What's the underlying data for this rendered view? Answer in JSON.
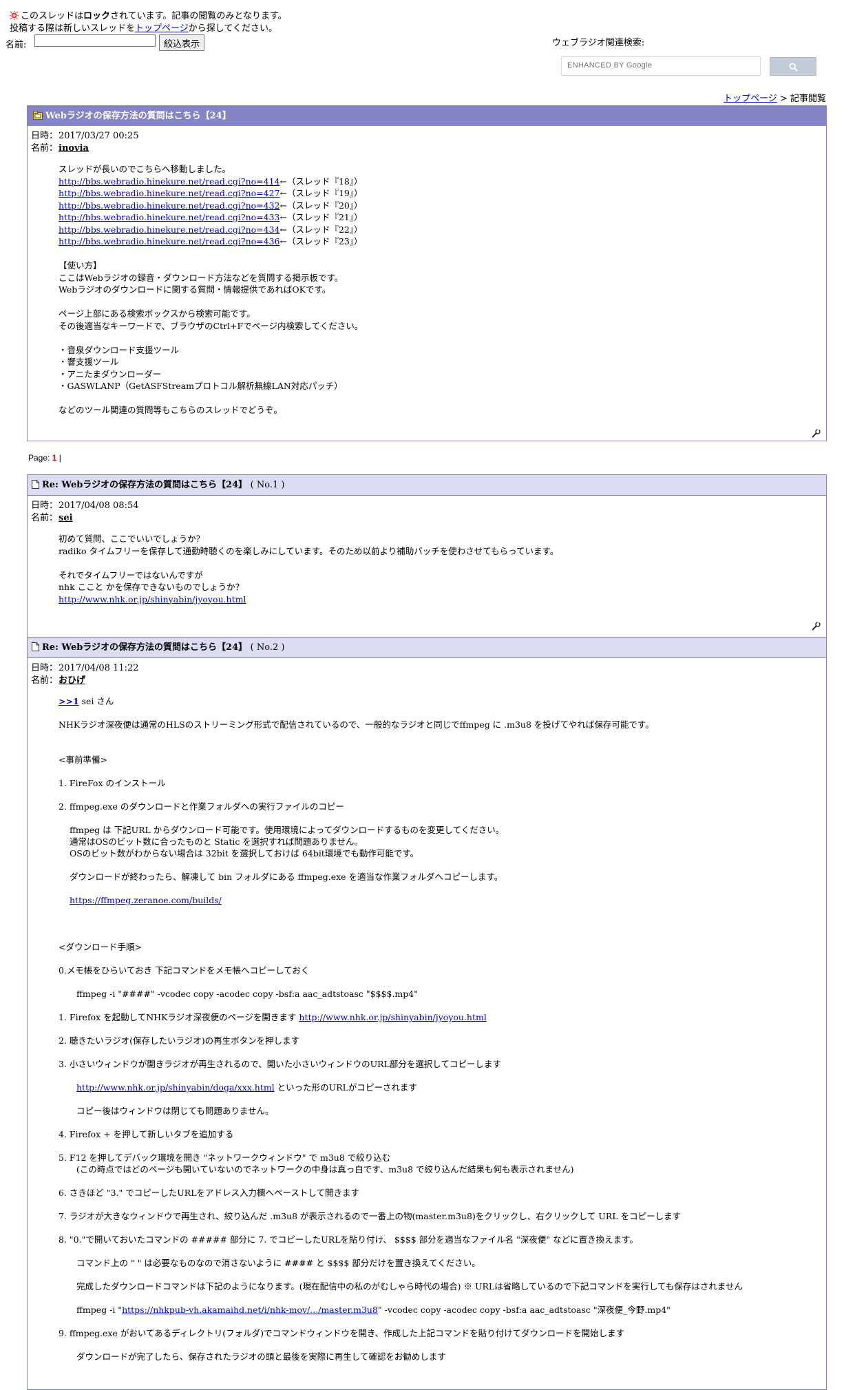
{
  "header": {
    "lock_pre": "このスレッドは",
    "lock_bold": "ロック",
    "lock_post": "されています。記事の閲覧のみとなります。",
    "new_pre": "投稿する際は新しいスレッドを",
    "new_link": "トップページ",
    "new_post": "から探してください。",
    "name_label": "名前:",
    "name_value": "",
    "filter_button": "絞込表示",
    "web_search_label": "ウェブラジオ関連検索:",
    "google_placeholder": "ENHANCED BY Google"
  },
  "breadcrumb": {
    "top": "トップページ",
    "sep": " > ",
    "current": "記事閲覧"
  },
  "thread": {
    "title": "Webラジオの保存方法の質問はこちら【24】",
    "date_label": "日時：",
    "date": "2017/03/27 00:25",
    "name_label": "名前：",
    "name": "inovia",
    "intro": "スレッドが長いのでこちらへ移動しました。",
    "links": [
      {
        "url": "http://bbs.webradio.hinekure.net/read.cgi?no=414",
        "note": "←（スレッド『18』）"
      },
      {
        "url": "http://bbs.webradio.hinekure.net/read.cgi?no=427",
        "note": "←（スレッド『19』）"
      },
      {
        "url": "http://bbs.webradio.hinekure.net/read.cgi?no=432",
        "note": "←（スレッド『20』）"
      },
      {
        "url": "http://bbs.webradio.hinekure.net/read.cgi?no=433",
        "note": "←（スレッド『21』）"
      },
      {
        "url": "http://bbs.webradio.hinekure.net/read.cgi?no=434",
        "note": "←（スレッド『22』）"
      },
      {
        "url": "http://bbs.webradio.hinekure.net/read.cgi?no=436",
        "note": "←（スレッド『23』）"
      }
    ],
    "usage_title": "【使い方】",
    "usage_1": "ここはWebラジオの録音・ダウンロード方法などを質問する掲示板です。",
    "usage_2": "Webラジオのダウンロードに関する質問・情報提供であればOKです。",
    "search_1": "ページ上部にある検索ボックスから検索可能です。",
    "search_2": "その後適当なキーワードで、ブラウザのCtrl+Fでページ内検索してください。",
    "tools": [
      "・音泉ダウンロード支援ツール",
      "・響支援ツール",
      "・アニたまダウンローダー",
      "・GASWLANP（GetASFStreamプロトコル解析無線LAN対応パッチ）"
    ],
    "outro": "などのツール関連の質問等もこちらのスレッドでどうぞ。"
  },
  "pager": {
    "label": "Page:",
    "current": "1",
    "sep": "|"
  },
  "post1": {
    "title": "Re: Webラジオの保存方法の質問はこちら【24】",
    "no": "( No.1 )",
    "date": "2017/04/08 08:54",
    "name": "sei",
    "l1": "初めて質問、ここでいいでしょうか？",
    "l2": "radiko タイムフリーを保存して通勤時聴くのを楽しみにしています。そのため以前より補助バッチを使わさせてもらっています。",
    "l3": "それでタイムフリーではないんですが",
    "l4": "nhk ここと かを保存できないものでしょうか？",
    "link": "http://www.nhk.or.jp/shinyabin/jyoyou.html"
  },
  "post2": {
    "title": "Re: Webラジオの保存方法の質問はこちら【24】",
    "no": "( No.2 )",
    "date": "2017/04/08 11:22",
    "name": "おひげ",
    "reply_link": ">>1",
    "reply_text": " sei さん",
    "p1": "NHKラジオ深夜便は通常のHLSのストリーミング形式で配信されているので、一般的なラジオと同じでffmpeg に .m3u8 を投げてやれば保存可能です。",
    "prep": "<事前準備>",
    "s1": "1. FireFox のインストール",
    "s2": "2. ffmpeg.exe のダウンロードと作業フォルダへの実行ファイルのコピー",
    "s2a": "ffmpeg は 下記URL からダウンロード可能です。使用環境によってダウンロードするものを変更してください。",
    "s2b": "通常はOSのビット数に合ったものと Static を選択すれば問題ありません。",
    "s2c": "OSのビット数がわからない場合は 32bit を選択しておけば 64bit環境でも動作可能です。",
    "s2d": "ダウンロードが終わったら、解凍して bin フォルダにある ffmpeg.exe を適当な作業フォルダへコピーします。",
    "s2link": "https://ffmpeg.zeranoe.com/builds/",
    "dl": "<ダウンロード手順>",
    "d0": "0.メモ帳をひらいておき 下記コマンドをメモ帳へコピーしておく",
    "d0cmd": "ffmpeg -i \"####\" -vcodec copy -acodec copy -bsf:a aac_adtstoasc \"$$$$.mp4\"",
    "d1": "1. Firefox を起動してNHKラジオ深夜便のページを開きます ",
    "d1link": "http://www.nhk.or.jp/shinyabin/jyoyou.html",
    "d2": "2. 聴きたいラジオ(保存したいラジオ)の再生ボタンを押します",
    "d3": "3. 小さいウィンドウが開きラジオが再生されるので、開いた小さいウィンドウのURL部分を選択してコピーします",
    "d3link": "http://www.nhk.or.jp/shinyabin/doga/xxx.html",
    "d3text": " といった形のURLがコピーされます",
    "d3b": "コピー後はウィンドウは閉じても問題ありません。",
    "d4": "4. Firefox + を押して新しいタブを追加する",
    "d5": "5. F12 を押してデバック環境を開き \"ネットワークウィンドウ\" で m3u8 で絞り込む",
    "d5b": "(この時点ではどのページも開いていないのでネットワークの中身は真っ白です、m3u8 で絞り込んだ結果も何も表示されません)",
    "d6": "6. さきほど \"3.\" でコピーしたURLをアドレス入力欄へペーストして開きます",
    "d7": "7. ラジオが大きなウィンドウで再生され、絞り込んだ .m3u8 が表示されるので一番上の物(master.m3u8)をクリックし、右クリックして URL をコピーします",
    "d8": "8. \"0.\"で開いておいたコマンドの ##### 部分に 7. でコピーしたURLを貼り付け、 $$$$ 部分を適当なファイル名 \"深夜便\" などに置き換えます。",
    "d8a": "コマンド上の \" \" は必要なものなので消さないように #### と $$$$ 部分だけを置き換えてください。",
    "d8b": "完成したダウンロードコマンドは下記のようになります。(現在配信中の私のがむしゃら時代の場合) ※ URLは省略しているので下記コマンドを実行しても保存はされません",
    "d8cmd_pre": "ffmpeg -i \"",
    "d8cmd_link": "https://nhkpub-vh.akamaihd.net/i/nhk-mov/.../master.m3u8",
    "d8cmd_post": "\" -vcodec copy -acodec copy -bsf:a aac_adtstoasc \"深夜便_今野.mp4\"",
    "d9": "9. ffmpeg.exe がおいてあるディレクトリ(フォルダ)でコマンドウィンドウを開き、作成した上記コマンドを貼り付けてダウンロードを開始します",
    "d9b": "ダウンロードが完了したら、保存されたラジオの頭と最後を実際に再生して確認をお勧めします"
  },
  "colors": {
    "panel_head": "#8484c6",
    "sub_head": "#dcdcf2",
    "border": "#7f7fbf",
    "link": "#0000cc",
    "page_current": "#cc0000"
  }
}
